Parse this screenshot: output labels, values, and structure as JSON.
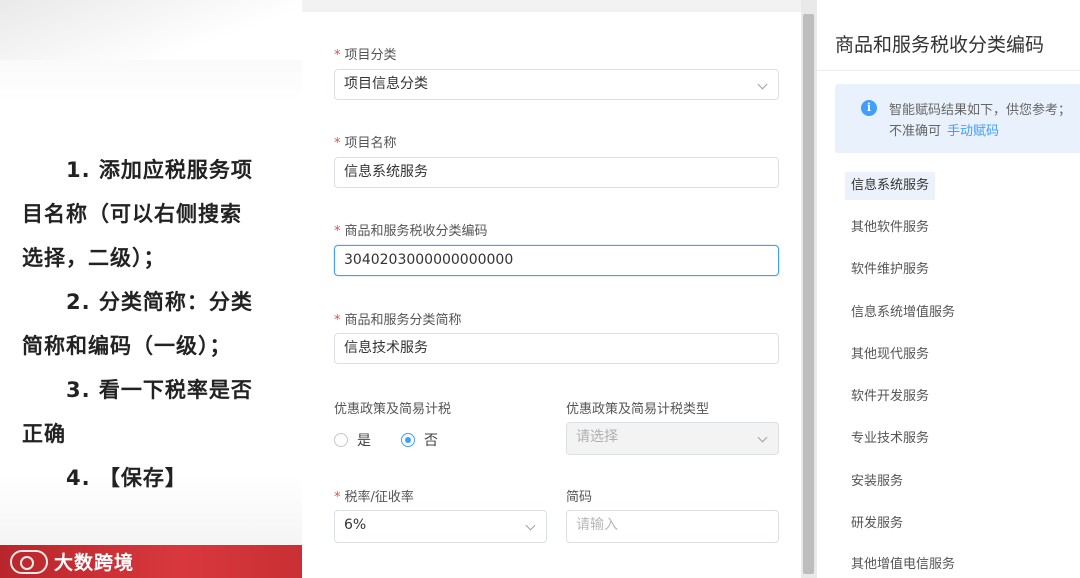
{
  "instructions": {
    "line1": "1. 添加应税服务项",
    "line2": "目名称（可以右侧搜索",
    "line3": "选择，二级）；",
    "line4": "2. 分类简称：分类",
    "line5": "简称和编码（一级）；",
    "line6": "3. 看一下税率是否",
    "line7": "正确",
    "line8": "4. 【保存】"
  },
  "brand": {
    "name": "大数跨境"
  },
  "form": {
    "required_mark": "*",
    "project_category": {
      "label": "项目分类",
      "value": "项目信息分类"
    },
    "project_name": {
      "label": "项目名称",
      "value": "信息系统服务"
    },
    "tax_code": {
      "label": "商品和服务税收分类编码",
      "value": "3040203000000000000"
    },
    "category_short": {
      "label": "商品和服务分类简称",
      "value": "信息技术服务"
    },
    "preferential": {
      "label": "优惠政策及简易计税",
      "options": [
        "是",
        "否"
      ],
      "selected": "否"
    },
    "preferential_type": {
      "label": "优惠政策及简易计税类型",
      "placeholder": "请选择"
    },
    "tax_rate": {
      "label": "税率/征收率",
      "value": "6%"
    },
    "short_code": {
      "label": "简码",
      "placeholder": "请输入"
    }
  },
  "code_panel": {
    "title": "商品和服务税收分类编码",
    "info_text": "智能赋码结果如下，供您参考；",
    "info_text2": "不准确可",
    "info_link": "手动赋码",
    "items": [
      "信息系统服务",
      "其他软件服务",
      "软件维护服务",
      "信息系统增值服务",
      "其他现代服务",
      "软件开发服务",
      "专业技术服务",
      "安装服务",
      "研发服务",
      "其他增值电信服务"
    ]
  },
  "colors": {
    "accent": "#409eff",
    "required": "#e14c4c",
    "brand": "#c92f34"
  }
}
